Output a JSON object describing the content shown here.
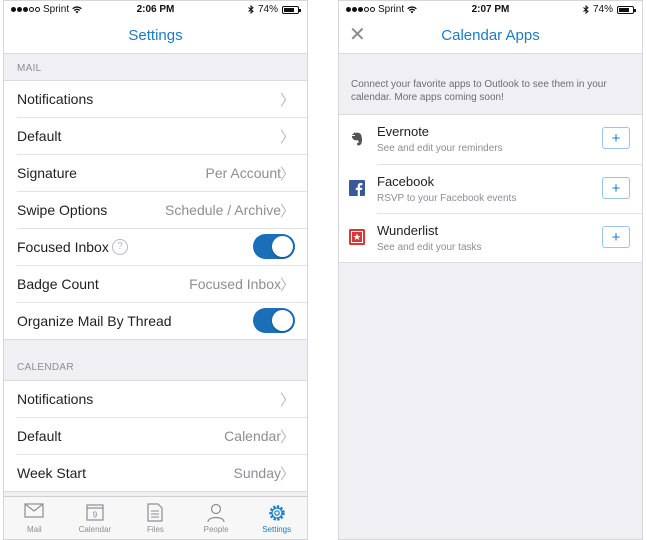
{
  "left": {
    "status": {
      "carrier": "Sprint",
      "time": "2:06 PM",
      "battery": "74%",
      "battery_level": 0.74
    },
    "title": "Settings",
    "mail_header": "MAIL",
    "mail_rows": [
      {
        "label": "Notifications",
        "value": ""
      },
      {
        "label": "Default",
        "value": ""
      },
      {
        "label": "Signature",
        "value": "Per Account"
      },
      {
        "label": "Swipe Options",
        "value": "Schedule / Archive"
      },
      {
        "label": "Focused Inbox",
        "toggle": true
      },
      {
        "label": "Badge Count",
        "value": "Focused Inbox"
      },
      {
        "label": "Organize Mail By Thread",
        "toggle": true
      }
    ],
    "calendar_header": "CALENDAR",
    "calendar_rows": [
      {
        "label": "Notifications",
        "value": ""
      },
      {
        "label": "Default",
        "value": "Calendar"
      },
      {
        "label": "Week Start",
        "value": "Sunday"
      }
    ],
    "help_glyph": "?",
    "calendar_tab_date": "9",
    "tabs": [
      {
        "label": "Mail",
        "icon": "mail-icon"
      },
      {
        "label": "Calendar",
        "icon": "calendar-icon"
      },
      {
        "label": "Files",
        "icon": "files-icon"
      },
      {
        "label": "People",
        "icon": "people-icon"
      },
      {
        "label": "Settings",
        "icon": "gear-icon",
        "active": true
      }
    ]
  },
  "right": {
    "status": {
      "carrier": "Sprint",
      "time": "2:07 PM",
      "battery": "74%",
      "battery_level": 0.74
    },
    "title": "Calendar Apps",
    "intro": "Connect your favorite apps to Outlook to see them in your calendar. More apps coming soon!",
    "apps": [
      {
        "name": "Evernote",
        "desc": "See and edit your reminders",
        "icon": "evernote-icon"
      },
      {
        "name": "Facebook",
        "desc": "RSVP to your Facebook events",
        "icon": "facebook-icon"
      },
      {
        "name": "Wunderlist",
        "desc": "See and edit your tasks",
        "icon": "wunderlist-icon"
      }
    ],
    "add_glyph": "+",
    "close_glyph": "✕"
  },
  "colors": {
    "accent": "#1a7bc9",
    "toggle_on": "#1a6fb8",
    "background": "#efeff4",
    "secondary_text": "#8e8e93"
  }
}
